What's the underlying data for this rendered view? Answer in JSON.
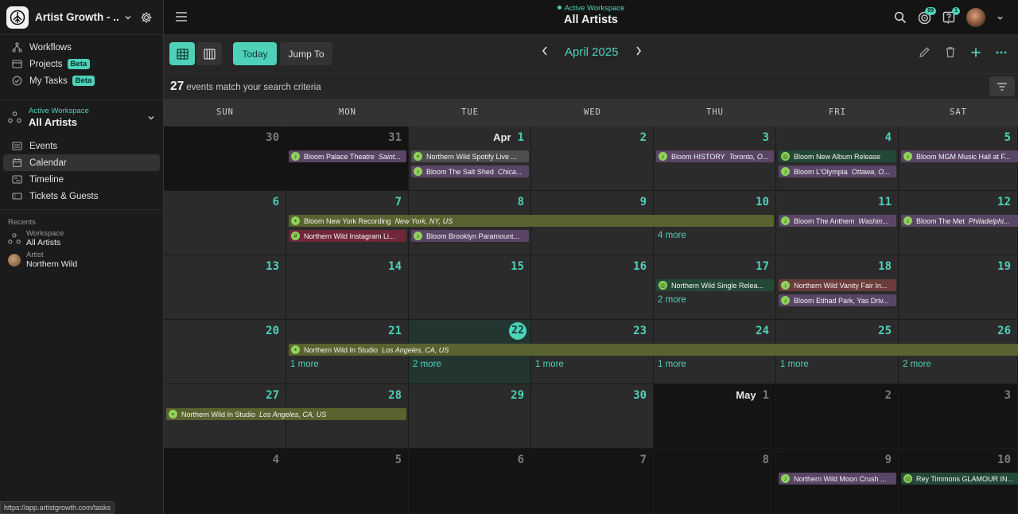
{
  "sidebar": {
    "app_title": "Artist Growth - ...",
    "nav": [
      {
        "label": "Workflows",
        "icon": "workflow-icon",
        "beta": ""
      },
      {
        "label": "Projects",
        "icon": "projects-icon",
        "beta": "Beta"
      },
      {
        "label": "My Tasks",
        "icon": "tasks-check-icon",
        "beta": "Beta"
      }
    ],
    "workspace": {
      "label": "Active Workspace",
      "name": "All Artists"
    },
    "nav2": [
      {
        "label": "Events",
        "icon": "events-list-icon"
      },
      {
        "label": "Calendar",
        "icon": "calendar-icon"
      },
      {
        "label": "Timeline",
        "icon": "timeline-icon"
      },
      {
        "label": "Tickets & Guests",
        "icon": "ticket-icon"
      }
    ],
    "recents": {
      "heading": "Recents",
      "items": [
        {
          "type": "Workspace",
          "name": "All Artists"
        },
        {
          "type": "Artist",
          "name": "Northern Wild"
        }
      ]
    },
    "status_url": "https://app.artistgrowth.com/tasks"
  },
  "header": {
    "label": "Active Workspace",
    "name": "All Artists",
    "badges": {
      "activity": "99",
      "help": "1"
    }
  },
  "toolbar": {
    "today": "Today",
    "jump_to": "Jump To",
    "month": "April 2025"
  },
  "countbar": {
    "count": "27",
    "text": "events match your search criteria"
  },
  "calendar": {
    "dow": [
      "SUN",
      "MON",
      "TUE",
      "WED",
      "THU",
      "FRI",
      "SAT"
    ],
    "weeks": [
      [
        {
          "n": "30",
          "out": true
        },
        {
          "n": "31",
          "out": true
        },
        {
          "n": "1",
          "mon": "Apr"
        },
        {
          "n": "2"
        },
        {
          "n": "3"
        },
        {
          "n": "4"
        },
        {
          "n": "5"
        }
      ],
      [
        {
          "n": "6"
        },
        {
          "n": "7"
        },
        {
          "n": "8"
        },
        {
          "n": "9"
        },
        {
          "n": "10"
        },
        {
          "n": "11"
        },
        {
          "n": "12"
        }
      ],
      [
        {
          "n": "13"
        },
        {
          "n": "14"
        },
        {
          "n": "15"
        },
        {
          "n": "16"
        },
        {
          "n": "17"
        },
        {
          "n": "18"
        },
        {
          "n": "19"
        }
      ],
      [
        {
          "n": "20"
        },
        {
          "n": "21"
        },
        {
          "n": "22",
          "today": true
        },
        {
          "n": "23"
        },
        {
          "n": "24"
        },
        {
          "n": "25"
        },
        {
          "n": "26"
        }
      ],
      [
        {
          "n": "27"
        },
        {
          "n": "28"
        },
        {
          "n": "29"
        },
        {
          "n": "30"
        },
        {
          "n": "1",
          "mon": "May",
          "out": true
        },
        {
          "n": "2",
          "out": true
        },
        {
          "n": "3",
          "out": true
        }
      ],
      [
        {
          "n": "4",
          "out": true
        },
        {
          "n": "5",
          "out": true
        },
        {
          "n": "6",
          "out": true
        },
        {
          "n": "7",
          "out": true
        },
        {
          "n": "8",
          "out": true
        },
        {
          "n": "9",
          "out": true
        },
        {
          "n": "10",
          "out": true
        }
      ]
    ],
    "events": [
      {
        "week": 0,
        "col": 1,
        "span": 1,
        "slot": 0,
        "color": "purple",
        "icon": "music-note-icon",
        "title": "Bloom  Palace Theatre",
        "loc": "Saint..."
      },
      {
        "week": 0,
        "col": 2,
        "span": 1,
        "slot": 0,
        "color": "grey",
        "icon": "location-pin-icon",
        "title": "Northern Wild  Spotify Live ...",
        "loc": ""
      },
      {
        "week": 0,
        "col": 2,
        "span": 1,
        "slot": 1,
        "color": "purple",
        "icon": "music-note-icon",
        "title": "Bloom  The Salt Shed",
        "loc": "Chica..."
      },
      {
        "week": 0,
        "col": 4,
        "span": 1,
        "slot": 0,
        "color": "purple",
        "icon": "music-note-icon",
        "title": "Bloom  HISTORY",
        "loc": "Toronto, O..."
      },
      {
        "week": 0,
        "col": 5,
        "span": 1,
        "slot": 0,
        "color": "green",
        "icon": "target-icon",
        "title": "Bloom  New Album Release",
        "loc": ""
      },
      {
        "week": 0,
        "col": 5,
        "span": 1,
        "slot": 1,
        "color": "purple",
        "icon": "music-note-icon",
        "title": "Bloom  L'Olympia",
        "loc": "Ottawa, O..."
      },
      {
        "week": 0,
        "col": 6,
        "span": 1,
        "slot": 0,
        "color": "purple",
        "icon": "music-note-icon",
        "title": "Bloom  MGM Music Hall at F...",
        "loc": ""
      },
      {
        "week": 1,
        "col": 1,
        "span": 4,
        "slot": 0,
        "color": "olive",
        "icon": "location-pin-icon",
        "title": "Bloom  New York Recording",
        "loc": "New York, NY, US"
      },
      {
        "week": 1,
        "col": 1,
        "span": 1,
        "slot": 1,
        "color": "red",
        "icon": "hashtag-icon",
        "title": "Northern Wild  Instagram Li...",
        "loc": ""
      },
      {
        "week": 1,
        "col": 2,
        "span": 1,
        "slot": 1,
        "color": "purple",
        "icon": "music-note-icon",
        "title": "Bloom  Brooklyn Paramount...",
        "loc": ""
      },
      {
        "week": 1,
        "col": 5,
        "span": 1,
        "slot": 0,
        "color": "purple",
        "icon": "music-note-icon",
        "title": "Bloom  The Anthem",
        "loc": "Washin..."
      },
      {
        "week": 1,
        "col": 6,
        "span": 1,
        "slot": 0,
        "color": "purple",
        "icon": "music-note-icon",
        "title": "Bloom  The Met",
        "loc": "Philadelphi..."
      },
      {
        "week": 2,
        "col": 4,
        "span": 1,
        "slot": 0,
        "color": "green",
        "icon": "target-icon",
        "title": "Northern Wild  Single Relea...",
        "loc": ""
      },
      {
        "week": 2,
        "col": 5,
        "span": 1,
        "slot": 0,
        "color": "redbrown",
        "icon": "microphone-icon",
        "title": "Northern Wild  Vanity Fair In...",
        "loc": ""
      },
      {
        "week": 2,
        "col": 5,
        "span": 1,
        "slot": 1,
        "color": "purple",
        "icon": "music-note-icon",
        "title": "Bloom  Etihad Park, Yas Driv...",
        "loc": ""
      },
      {
        "week": 3,
        "col": 1,
        "span": 6,
        "slot": 0,
        "color": "olive",
        "icon": "location-pin-icon",
        "title": "Northern Wild  In Studio",
        "loc": "Los Angeles, CA, US"
      },
      {
        "week": 4,
        "col": 0,
        "span": 2,
        "slot": 0,
        "color": "olive",
        "icon": "location-pin-icon",
        "title": "Northern Wild  In Studio",
        "loc": "Los Angeles, CA, US"
      },
      {
        "week": 5,
        "col": 5,
        "span": 1,
        "slot": 0,
        "color": "purple",
        "icon": "music-note-icon",
        "title": "Northern Wild  Moon Crush ...",
        "loc": ""
      },
      {
        "week": 5,
        "col": 6,
        "span": 1,
        "slot": 0,
        "color": "green",
        "icon": "target-icon",
        "title": "Rey Timmons  GLAMOUR IN...",
        "loc": ""
      }
    ],
    "more": [
      {
        "week": 1,
        "col": 4,
        "slot": 1,
        "label": "4 more"
      },
      {
        "week": 2,
        "col": 4,
        "slot": 1,
        "label": "2 more"
      },
      {
        "week": 3,
        "col": 1,
        "slot": 1,
        "label": "1 more"
      },
      {
        "week": 3,
        "col": 2,
        "slot": 1,
        "label": "2 more"
      },
      {
        "week": 3,
        "col": 3,
        "slot": 1,
        "label": "1 more"
      },
      {
        "week": 3,
        "col": 4,
        "slot": 1,
        "label": "1 more"
      },
      {
        "week": 3,
        "col": 5,
        "slot": 1,
        "label": "1 more"
      },
      {
        "week": 3,
        "col": 6,
        "slot": 1,
        "label": "2 more"
      }
    ]
  }
}
